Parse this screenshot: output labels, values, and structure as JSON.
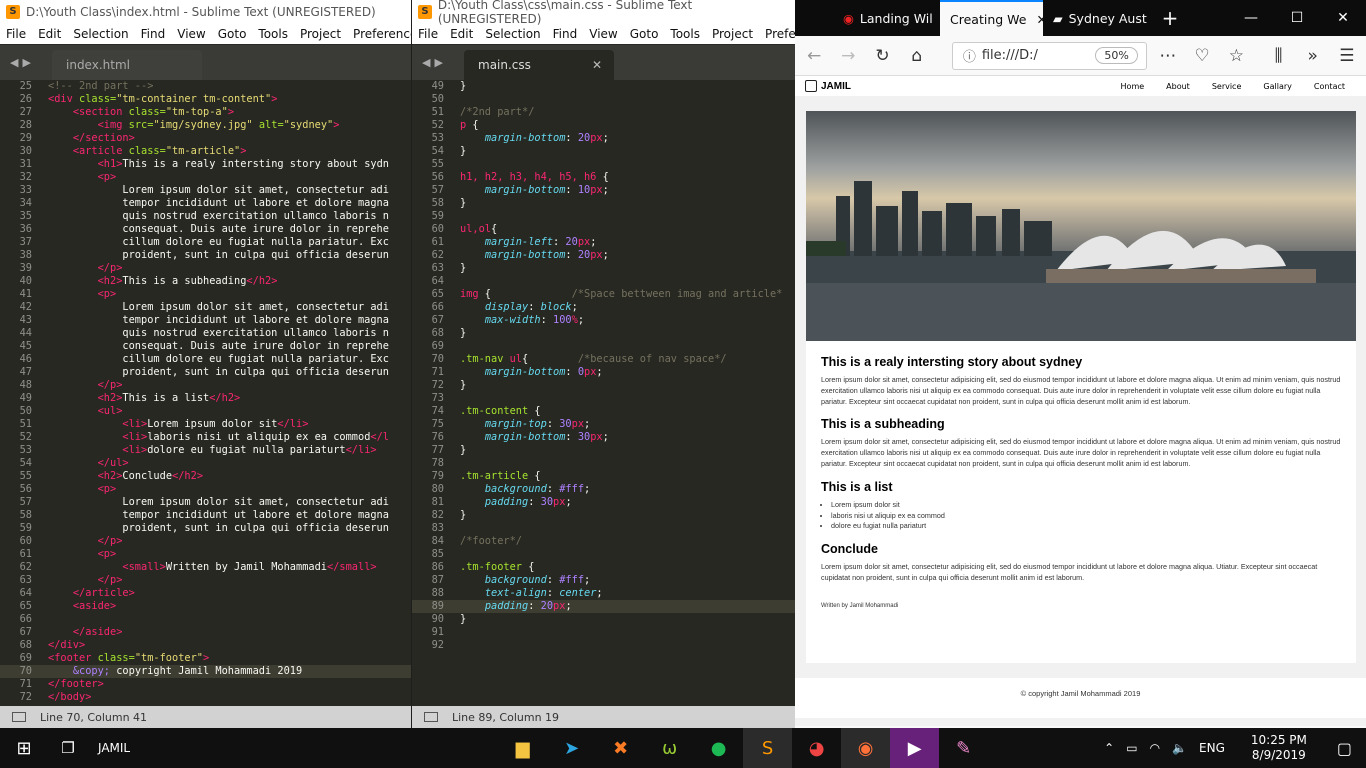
{
  "win1": {
    "title": "D:\\Youth Class\\index.html - Sublime Text (UNREGISTERED)",
    "menu": [
      "File",
      "Edit",
      "Selection",
      "Find",
      "View",
      "Goto",
      "Tools",
      "Project",
      "Preferences"
    ],
    "tab_label": "index.html",
    "status": "Line 70, Column 41",
    "lines": [
      {
        "n": "25",
        "h": "<span class='cmt'>&lt;!-- 2nd part --&gt;</span>"
      },
      {
        "n": "26",
        "h": "<span class='tag'>&lt;div</span> <span class='attr'>class=</span><span class='str'>\"tm-container tm-content\"</span><span class='tag'>&gt;</span>"
      },
      {
        "n": "27",
        "h": "    <span class='tag'>&lt;section</span> <span class='attr'>class=</span><span class='str'>\"tm-top-a\"</span><span class='tag'>&gt;</span>"
      },
      {
        "n": "28",
        "h": "        <span class='tag'>&lt;img</span> <span class='attr'>src=</span><span class='str'>\"img/sydney.jpg\"</span> <span class='attr'>alt=</span><span class='str'>\"sydney\"</span><span class='tag'>&gt;</span>"
      },
      {
        "n": "29",
        "h": "    <span class='tag'>&lt;/section&gt;</span>"
      },
      {
        "n": "30",
        "h": "    <span class='tag'>&lt;article</span> <span class='attr'>class=</span><span class='str'>\"tm-article\"</span><span class='tag'>&gt;</span>"
      },
      {
        "n": "31",
        "h": "        <span class='tag'>&lt;h1&gt;</span>This is a realy intersting story about sydn"
      },
      {
        "n": "32",
        "h": "        <span class='tag'>&lt;p&gt;</span>"
      },
      {
        "n": "33",
        "h": "            Lorem ipsum dolor sit amet, consectetur adi"
      },
      {
        "n": "34",
        "h": "            tempor incididunt ut labore et dolore magna"
      },
      {
        "n": "35",
        "h": "            quis nostrud exercitation ullamco laboris n"
      },
      {
        "n": "36",
        "h": "            consequat. Duis aute irure dolor in reprehe"
      },
      {
        "n": "37",
        "h": "            cillum dolore eu fugiat nulla pariatur. Exc"
      },
      {
        "n": "38",
        "h": "            proident, sunt in culpa qui officia deserun"
      },
      {
        "n": "39",
        "h": "        <span class='tag'>&lt;/p&gt;</span>"
      },
      {
        "n": "40",
        "h": "        <span class='tag'>&lt;h2&gt;</span>This is a subheading<span class='tag'>&lt;/h2&gt;</span>"
      },
      {
        "n": "41",
        "h": "        <span class='tag'>&lt;p&gt;</span>"
      },
      {
        "n": "42",
        "h": "            Lorem ipsum dolor sit amet, consectetur adi"
      },
      {
        "n": "43",
        "h": "            tempor incididunt ut labore et dolore magna"
      },
      {
        "n": "44",
        "h": "            quis nostrud exercitation ullamco laboris n"
      },
      {
        "n": "45",
        "h": "            consequat. Duis aute irure dolor in reprehe"
      },
      {
        "n": "46",
        "h": "            cillum dolore eu fugiat nulla pariatur. Exc"
      },
      {
        "n": "47",
        "h": "            proident, sunt in culpa qui officia deserun"
      },
      {
        "n": "48",
        "h": "        <span class='tag'>&lt;/p&gt;</span>"
      },
      {
        "n": "49",
        "h": "        <span class='tag'>&lt;h2&gt;</span>This is a list<span class='tag'>&lt;/h2&gt;</span>"
      },
      {
        "n": "50",
        "h": "        <span class='tag'>&lt;ul&gt;</span>"
      },
      {
        "n": "51",
        "h": "            <span class='tag'>&lt;li&gt;</span>Lorem ipsum dolor sit<span class='tag'>&lt;/li&gt;</span>"
      },
      {
        "n": "52",
        "h": "            <span class='tag'>&lt;li&gt;</span>laboris nisi ut aliquip ex ea commod<span class='tag'>&lt;/l</span>"
      },
      {
        "n": "53",
        "h": "            <span class='tag'>&lt;li&gt;</span>dolore eu fugiat nulla pariaturt<span class='tag'>&lt;/li&gt;</span>"
      },
      {
        "n": "54",
        "h": "        <span class='tag'>&lt;/ul&gt;</span>"
      },
      {
        "n": "55",
        "h": "        <span class='tag'>&lt;h2&gt;</span>Conclude<span class='tag'>&lt;/h2&gt;</span>"
      },
      {
        "n": "56",
        "h": "        <span class='tag'>&lt;p&gt;</span>"
      },
      {
        "n": "57",
        "h": "            Lorem ipsum dolor sit amet, consectetur adi"
      },
      {
        "n": "58",
        "h": "            tempor incididunt ut labore et dolore magna"
      },
      {
        "n": "59",
        "h": "            proident, sunt in culpa qui officia deserun"
      },
      {
        "n": "60",
        "h": "        <span class='tag'>&lt;/p&gt;</span>"
      },
      {
        "n": "61",
        "h": "        <span class='tag'>&lt;p&gt;</span>"
      },
      {
        "n": "62",
        "h": "            <span class='tag'>&lt;small&gt;</span>Written by Jamil Mohammadi<span class='tag'>&lt;/small&gt;</span>"
      },
      {
        "n": "63",
        "h": "        <span class='tag'>&lt;/p&gt;</span>"
      },
      {
        "n": "64",
        "h": "    <span class='tag'>&lt;/article&gt;</span>"
      },
      {
        "n": "65",
        "h": "    <span class='tag'>&lt;aside&gt;</span>"
      },
      {
        "n": "66",
        "h": ""
      },
      {
        "n": "67",
        "h": "    <span class='tag'>&lt;/aside&gt;</span>"
      },
      {
        "n": "68",
        "h": "<span class='tag'>&lt;/div&gt;</span>"
      },
      {
        "n": "69",
        "h": "<span class='tag'>&lt;footer</span> <span class='attr'>class=</span><span class='str'>\"tm-footer\"</span><span class='tag'>&gt;</span>"
      },
      {
        "n": "70",
        "h": "    <span class='ent'>&amp;copy;</span> copyright Jamil Mohammadi 2019",
        "hl": true
      },
      {
        "n": "71",
        "h": "<span class='tag'>&lt;/footer&gt;</span>"
      },
      {
        "n": "72",
        "h": "<span class='tag'>&lt;/body&gt;</span>"
      }
    ]
  },
  "win2": {
    "title": "D:\\Youth Class\\css\\main.css - Sublime Text (UNREGISTERED)",
    "menu": [
      "File",
      "Edit",
      "Selection",
      "Find",
      "View",
      "Goto",
      "Tools",
      "Project",
      "Prefere"
    ],
    "tab_label": "main.css",
    "status": "Line 89, Column 19",
    "lines": [
      {
        "n": "49",
        "h": "}"
      },
      {
        "n": "50",
        "h": ""
      },
      {
        "n": "51",
        "h": "<span class='cmt'>/*2nd part*/</span>"
      },
      {
        "n": "52",
        "h": "<span class='kw'>p</span> {"
      },
      {
        "n": "53",
        "h": "    <span class='prop'>margin-bottom</span>: <span class='num'>20</span><span class='kw'>px</span>;"
      },
      {
        "n": "54",
        "h": "}"
      },
      {
        "n": "55",
        "h": ""
      },
      {
        "n": "56",
        "h": "<span class='kw'>h1, h2, h3, h4, h5, h6</span> {"
      },
      {
        "n": "57",
        "h": "    <span class='prop'>margin-bottom</span>: <span class='num'>10</span><span class='kw'>px</span>;"
      },
      {
        "n": "58",
        "h": "}"
      },
      {
        "n": "59",
        "h": ""
      },
      {
        "n": "60",
        "h": "<span class='kw'>ul,ol</span>{"
      },
      {
        "n": "61",
        "h": "    <span class='prop'>margin-left</span>: <span class='num'>20</span><span class='kw'>px</span>;"
      },
      {
        "n": "62",
        "h": "    <span class='prop'>margin-bottom</span>: <span class='num'>20</span><span class='kw'>px</span>;"
      },
      {
        "n": "63",
        "h": "}"
      },
      {
        "n": "64",
        "h": ""
      },
      {
        "n": "65",
        "h": "<span class='kw'>img</span> {             <span class='cmt'>/*Space bettween imag and article*</span>"
      },
      {
        "n": "66",
        "h": "    <span class='prop'>display</span>: <span class='prop'>block</span>;"
      },
      {
        "n": "67",
        "h": "    <span class='prop'>max-width</span>: <span class='num'>100</span><span class='kw'>%</span>;"
      },
      {
        "n": "68",
        "h": "}"
      },
      {
        "n": "69",
        "h": ""
      },
      {
        "n": "70",
        "h": "<span class='sel'>.tm-nav</span> <span class='kw'>ul</span>{        <span class='cmt'>/*because of nav space*/</span>"
      },
      {
        "n": "71",
        "h": "    <span class='prop'>margin-bottom</span>: <span class='num'>0</span><span class='kw'>px</span>;"
      },
      {
        "n": "72",
        "h": "}"
      },
      {
        "n": "73",
        "h": ""
      },
      {
        "n": "74",
        "h": "<span class='sel'>.tm-content</span> {"
      },
      {
        "n": "75",
        "h": "    <span class='prop'>margin-top</span>: <span class='num'>30</span><span class='kw'>px</span>;"
      },
      {
        "n": "76",
        "h": "    <span class='prop'>margin-bottom</span>: <span class='num'>30</span><span class='kw'>px</span>;"
      },
      {
        "n": "77",
        "h": "}"
      },
      {
        "n": "78",
        "h": ""
      },
      {
        "n": "79",
        "h": "<span class='sel'>.tm-article</span> {"
      },
      {
        "n": "80",
        "h": "    <span class='prop'>background</span>: <span class='num'>#fff</span>;"
      },
      {
        "n": "81",
        "h": "    <span class='prop'>padding</span>: <span class='num'>30</span><span class='kw'>px</span>;"
      },
      {
        "n": "82",
        "h": "}"
      },
      {
        "n": "83",
        "h": ""
      },
      {
        "n": "84",
        "h": "<span class='cmt'>/*footer*/</span>"
      },
      {
        "n": "85",
        "h": ""
      },
      {
        "n": "86",
        "h": "<span class='sel'>.tm-footer</span> {"
      },
      {
        "n": "87",
        "h": "    <span class='prop'>background</span>: <span class='num'>#fff</span>;"
      },
      {
        "n": "88",
        "h": "    <span class='prop'>text-align</span>: <span class='prop'>center</span>;"
      },
      {
        "n": "89",
        "h": "    <span class='prop'>padding</span>: <span class='num'>20</span><span class='kw'>px</span>;",
        "hl": true
      },
      {
        "n": "90",
        "h": "}"
      },
      {
        "n": "91",
        "h": ""
      },
      {
        "n": "92",
        "h": ""
      }
    ]
  },
  "firefox": {
    "tabs": [
      "Landing Wil",
      "Creating We",
      "Sydney Aust"
    ],
    "url": "file:///D:/",
    "zoom": "50%",
    "page": {
      "logo": "JAMIL",
      "nav": [
        "Home",
        "About",
        "Service",
        "Gallary",
        "Contact"
      ],
      "h1": "This is a realy intersting story about sydney",
      "p1": "Lorem ipsum dolor sit amet, consectetur adipisicing elit, sed do eiusmod tempor incididunt ut labore et dolore magna aliqua. Ut enim ad minim veniam, quis nostrud exercitation ullamco laboris nisi ut aliquip ex ea commodo consequat. Duis aute irure dolor in reprehenderit in voluptate velit esse cillum dolore eu fugiat nulla pariatur. Excepteur sint occaecat cupidatat non proident, sunt in culpa qui officia deserunt mollit anim id est laborum.",
      "h2a": "This is a subheading",
      "p2": "Lorem ipsum dolor sit amet, consectetur adipisicing elit, sed do eiusmod tempor incididunt ut labore et dolore magna aliqua. Ut enim ad minim veniam, quis nostrud exercitation ullamco laboris nisi ut aliquip ex ea commodo consequat. Duis aute irure dolor in reprehenderit in voluptate velit esse cillum dolore eu fugiat nulla pariatur. Excepteur sint occaecat cupidatat non proident, sunt in culpa qui officia deserunt mollit anim id est laborum.",
      "h2b": "This is a list",
      "list": [
        "Lorem ipsum dolor sit",
        "laboris nisi ut aliquip ex ea commod",
        "dolore eu fugiat nulla pariaturt"
      ],
      "h2c": "Conclude",
      "p3": "Lorem ipsum dolor sit amet, consectetur adipisicing elit, sed do eiusmod tempor incididunt ut labore et dolore magna aliqua. Utiatur. Excepteur sint occaecat cupidatat non proident, sunt in culpa qui officia deserunt mollit anim id est laborum.",
      "small": "Written by Jamil Mohammadi",
      "footer": "© copyright Jamil Mohammadi 2019"
    }
  },
  "taskbar": {
    "user": "JAMIL",
    "lang": "ENG",
    "time": "10:25 PM",
    "date": "8/9/2019"
  }
}
